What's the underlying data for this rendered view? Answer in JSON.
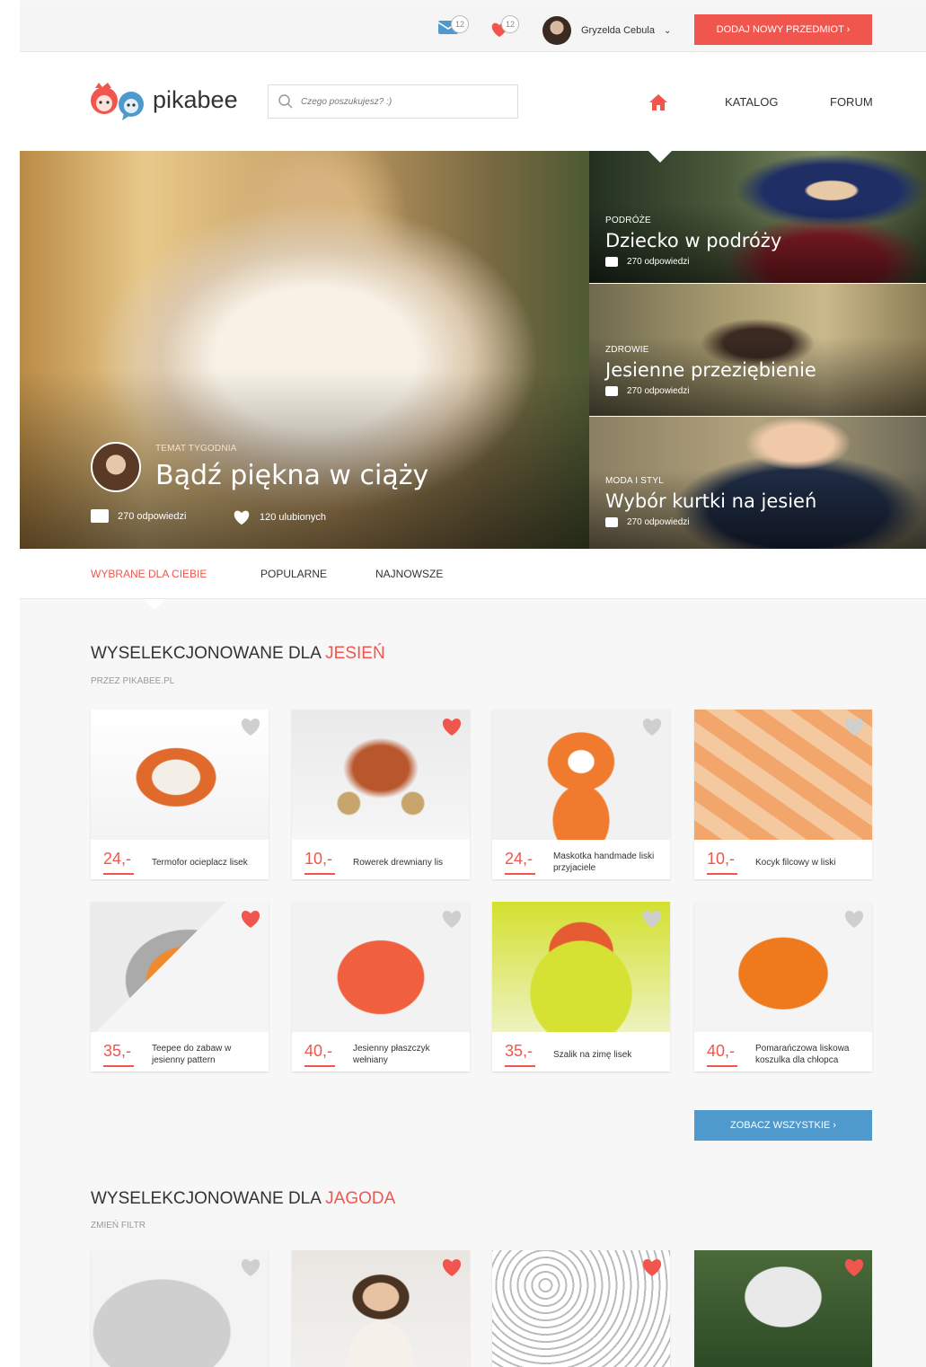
{
  "topbar": {
    "messages_count": "12",
    "favorites_count": "12",
    "user_name": "Gryzelda Cebula",
    "add_button": "DODAJ NOWY PRZEDMIOT  ›"
  },
  "header": {
    "logo_text": "pikabee",
    "search_placeholder": "Czego poszukujesz? :)",
    "nav": {
      "catalog": "KATALOG",
      "forum": "FORUM"
    }
  },
  "hero": {
    "main": {
      "category": "TEMAT TYGODNIA",
      "title": "Bądź piękna w ciąży",
      "replies": "270 odpowiedzi",
      "favorites": "120 ulubionych"
    },
    "side": [
      {
        "category": "PODRÓŻE",
        "title": "Dziecko w podróży",
        "replies": "270 odpowiedzi"
      },
      {
        "category": "ZDROWIE",
        "title": "Jesienne przeziębienie",
        "replies": "270 odpowiedzi"
      },
      {
        "category": "MODA I STYL",
        "title": "Wybór kurtki na jesień",
        "replies": "270 odpowiedzi"
      }
    ]
  },
  "tabs": [
    "WYBRANE DLA CIEBIE",
    "POPULARNE",
    "NAJNOWSZE"
  ],
  "section1": {
    "title_prefix": "WYSELEKCJONOWANE DLA ",
    "title_accent": "JESIEŃ",
    "subtitle": "PRZEZ PIKABEE.PL",
    "products": [
      {
        "price": "24,-",
        "name": "Termofor ocieplacz lisek",
        "fav": false
      },
      {
        "price": "10,-",
        "name": "Rowerek drewniany lis",
        "fav": true
      },
      {
        "price": "24,-",
        "name": "Maskotka handmade liski przyjaciele",
        "fav": false
      },
      {
        "price": "10,-",
        "name": "Kocyk filcowy w liski",
        "fav": false
      },
      {
        "price": "35,-",
        "name": "Teepee do zabaw w jesienny pattern",
        "fav": true
      },
      {
        "price": "40,-",
        "name": "Jesienny płaszczyk wełniany",
        "fav": false
      },
      {
        "price": "35,-",
        "name": "Szalik na zimę lisek",
        "fav": false
      },
      {
        "price": "40,-",
        "name": "Pomarańczowa liskowa koszulka dla chłopca",
        "fav": false
      }
    ],
    "see_all": "ZOBACZ WSZYSTKIE   ›"
  },
  "section2": {
    "title_prefix": "WYSELEKCJONOWANE DLA ",
    "title_accent": "JAGODA",
    "subtitle": "ZMIEŃ FILTR",
    "favs": [
      false,
      true,
      true,
      true
    ]
  },
  "colors": {
    "accent": "#f0564e",
    "blue": "#4e9acd"
  }
}
